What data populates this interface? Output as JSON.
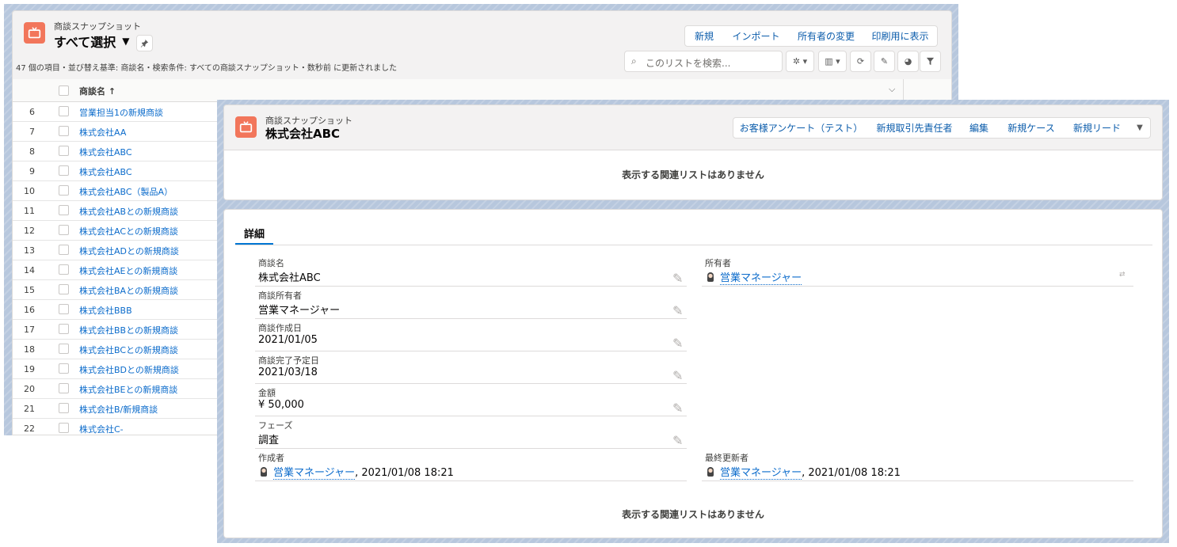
{
  "list": {
    "object_label": "商談スナップショット",
    "view_name": "すべて選択",
    "status": "47 個の項目・並び替え基準: 商談名・検索条件: すべての商談スナップショット・数秒前 に更新されました",
    "buttons": [
      "新規",
      "インポート",
      "所有者の変更",
      "印刷用に表示"
    ],
    "search_placeholder": "このリストを検索...",
    "column_header": "商談名 ↑",
    "rows": [
      {
        "num": "6",
        "name": "営業担当1の新規商談"
      },
      {
        "num": "7",
        "name": "株式会社AA"
      },
      {
        "num": "8",
        "name": "株式会社ABC"
      },
      {
        "num": "9",
        "name": "株式会社ABC"
      },
      {
        "num": "10",
        "name": "株式会社ABC（製品A）"
      },
      {
        "num": "11",
        "name": "株式会社ABとの新規商談"
      },
      {
        "num": "12",
        "name": "株式会社ACとの新規商談"
      },
      {
        "num": "13",
        "name": "株式会社ADとの新規商談"
      },
      {
        "num": "14",
        "name": "株式会社AEとの新規商談"
      },
      {
        "num": "15",
        "name": "株式会社BAとの新規商談"
      },
      {
        "num": "16",
        "name": "株式会社BBB"
      },
      {
        "num": "17",
        "name": "株式会社BBとの新規商談"
      },
      {
        "num": "18",
        "name": "株式会社BCとの新規商談"
      },
      {
        "num": "19",
        "name": "株式会社BDとの新規商談"
      },
      {
        "num": "20",
        "name": "株式会社BEとの新規商談"
      },
      {
        "num": "21",
        "name": "株式会社B/新規商談"
      },
      {
        "num": "22",
        "name": "株式会社C-"
      }
    ]
  },
  "record": {
    "object_label": "商談スナップショット",
    "title": "株式会社ABC",
    "actions": [
      "お客様アンケート（テスト）",
      "新規取引先責任者",
      "編集",
      "新規ケース",
      "新規リード"
    ],
    "no_related": "表示する関連リストはありません",
    "tab": "詳細",
    "fields": {
      "name": {
        "label": "商談名",
        "value": "株式会社ABC"
      },
      "owner": {
        "label": "商談所有者",
        "value": "営業マネージャー"
      },
      "created": {
        "label": "商談作成日",
        "value": "2021/01/05"
      },
      "close": {
        "label": "商談完了予定日",
        "value": "2021/03/18"
      },
      "amount": {
        "label": "金額",
        "value": "¥ 50,000"
      },
      "phase": {
        "label": "フェーズ",
        "value": "調査"
      },
      "record_owner": {
        "label": "所有者",
        "value": "営業マネージャー"
      },
      "created_by": {
        "label": "作成者",
        "user": "営業マネージャー",
        "suffix": ", 2021/01/08 18:21"
      },
      "modified_by": {
        "label": "最終更新者",
        "user": "営業マネージャー",
        "suffix": ", 2021/01/08 18:21"
      }
    }
  },
  "colors": {
    "accent": "#f2765b",
    "link": "#0b6bcb",
    "brand_blue": "#0176d3"
  }
}
